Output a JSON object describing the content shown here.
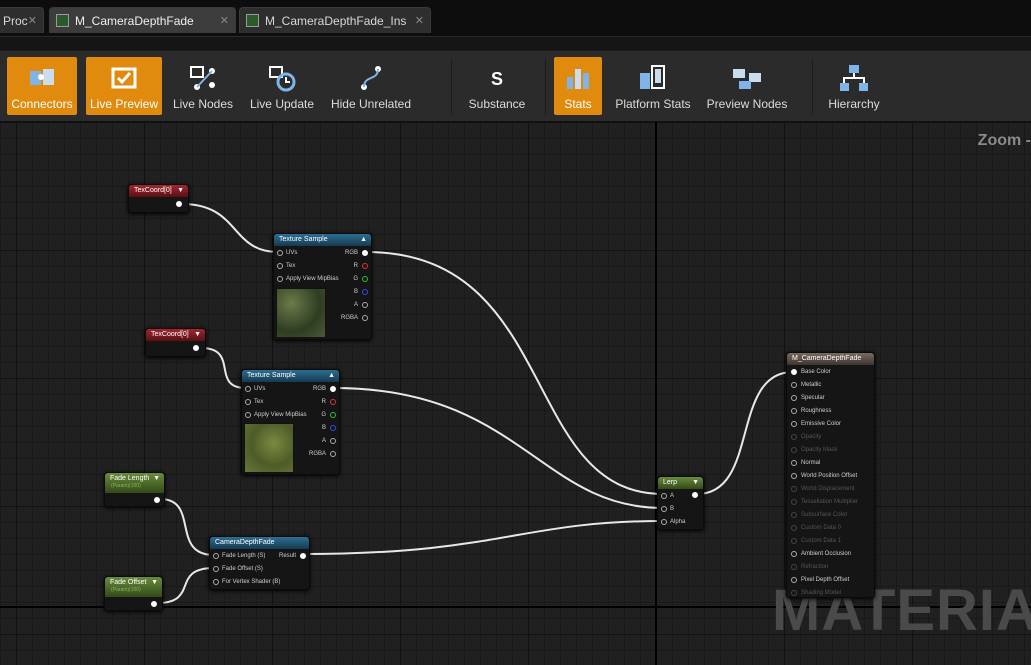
{
  "tabs": [
    {
      "label": "Proc"
    },
    {
      "label": "M_CameraDepthFade"
    },
    {
      "label": "M_CameraDepthFade_Ins"
    }
  ],
  "toolbar": {
    "connectors": "Connectors",
    "live_preview": "Live Preview",
    "live_nodes": "Live Nodes",
    "live_update": "Live Update",
    "hide_unrelated": "Hide Unrelated",
    "substance": "Substance",
    "stats": "Stats",
    "platform_stats": "Platform Stats",
    "preview_nodes": "Preview Nodes",
    "hierarchy": "Hierarchy"
  },
  "graph": {
    "zoom": "Zoom -",
    "watermark": "MATERIAL"
  },
  "nodes": {
    "texcoord1": {
      "title": "TexCoord[0]"
    },
    "texcoord2": {
      "title": "TexCoord[0]"
    },
    "texsample1": {
      "title": "Texture Sample",
      "in": [
        "UVs",
        "Tex",
        "Apply View MipBias"
      ],
      "out": [
        "RGB",
        "R",
        "G",
        "B",
        "A",
        "RGBA"
      ]
    },
    "texsample2": {
      "title": "Texture Sample",
      "in": [
        "UVs",
        "Tex",
        "Apply View MipBias"
      ],
      "out": [
        "RGB",
        "R",
        "G",
        "B",
        "A",
        "RGBA"
      ]
    },
    "fade_length": {
      "title": "Fade Length",
      "sub": "(Param)(100)"
    },
    "fade_offset": {
      "title": "Fade Offset",
      "sub": "(Param)(100)"
    },
    "camdepth": {
      "title": "CameraDepthFade",
      "in": [
        "Fade Length (S)",
        "Fade Offset (S)",
        "For Vertex Shader (B)"
      ],
      "out": "Result"
    },
    "lerp": {
      "title": "Lerp",
      "in": [
        "A",
        "B",
        "Alpha"
      ]
    },
    "material": {
      "title": "M_CameraDepthFade",
      "pins": [
        "Base Color",
        "Metallic",
        "Specular",
        "Roughness",
        "Emissive Color",
        "Opacity",
        "Opacity Mask",
        "Normal",
        "World Position Offset",
        "World Displacement",
        "Tessellation Multiplier",
        "Subsurface Color",
        "Custom Data 0",
        "Custom Data 1",
        "Ambient Occlusion",
        "Refraction",
        "Pixel Depth Offset",
        "Shading Model"
      ]
    }
  },
  "colors": {
    "accent": "#e08a0e",
    "pin_r": "#e03030",
    "pin_g": "#30c030",
    "pin_b": "#3050e0"
  }
}
